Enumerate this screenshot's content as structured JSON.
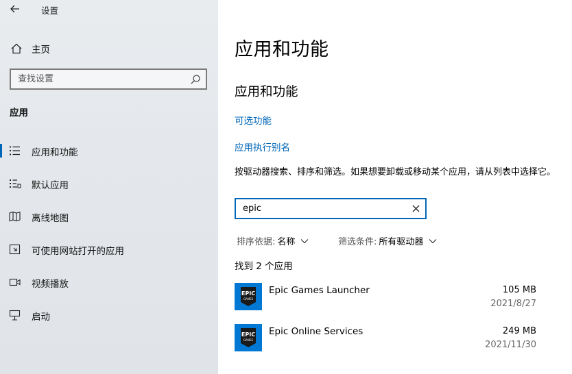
{
  "window": {
    "title": "设置"
  },
  "sidebar": {
    "home_label": "主页",
    "search_placeholder": "查找设置",
    "section_label": "应用",
    "items": [
      {
        "label": "应用和功能",
        "icon": "apps-features-icon",
        "selected": true
      },
      {
        "label": "默认应用",
        "icon": "default-apps-icon",
        "selected": false
      },
      {
        "label": "离线地图",
        "icon": "offline-maps-icon",
        "selected": false
      },
      {
        "label": "可使用网站打开的应用",
        "icon": "apps-for-websites-icon",
        "selected": false
      },
      {
        "label": "视频播放",
        "icon": "video-playback-icon",
        "selected": false
      },
      {
        "label": "启动",
        "icon": "startup-icon",
        "selected": false
      }
    ]
  },
  "main": {
    "title": "应用和功能",
    "subtitle": "应用和功能",
    "links": {
      "optional_features": "可选功能",
      "app_execution_aliases": "应用执行别名"
    },
    "description": "按驱动器搜索、排序和筛选。如果想要卸载或移动某个应用，请从列表中选择它。",
    "filter": {
      "value": "epic",
      "clear_icon": "clear-x-icon"
    },
    "sort": {
      "label": "排序依据:",
      "value": "名称"
    },
    "filter_by": {
      "label": "筛选条件:",
      "value": "所有驱动器"
    },
    "found_text": "找到 2 个应用",
    "apps": [
      {
        "name": "Epic Games Launcher",
        "size": "105 MB",
        "date": "2021/8/27",
        "logo_text_top": "EPIC",
        "logo_text_bottom": "GAMES"
      },
      {
        "name": "Epic Online Services",
        "size": "249 MB",
        "date": "2021/11/30",
        "logo_text_top": "EPIC",
        "logo_text_bottom": "GAMES"
      }
    ]
  },
  "colors": {
    "accent": "#0067b8",
    "sidebar_bg": "#e6e9ec",
    "app_tile": "#0078d4"
  }
}
